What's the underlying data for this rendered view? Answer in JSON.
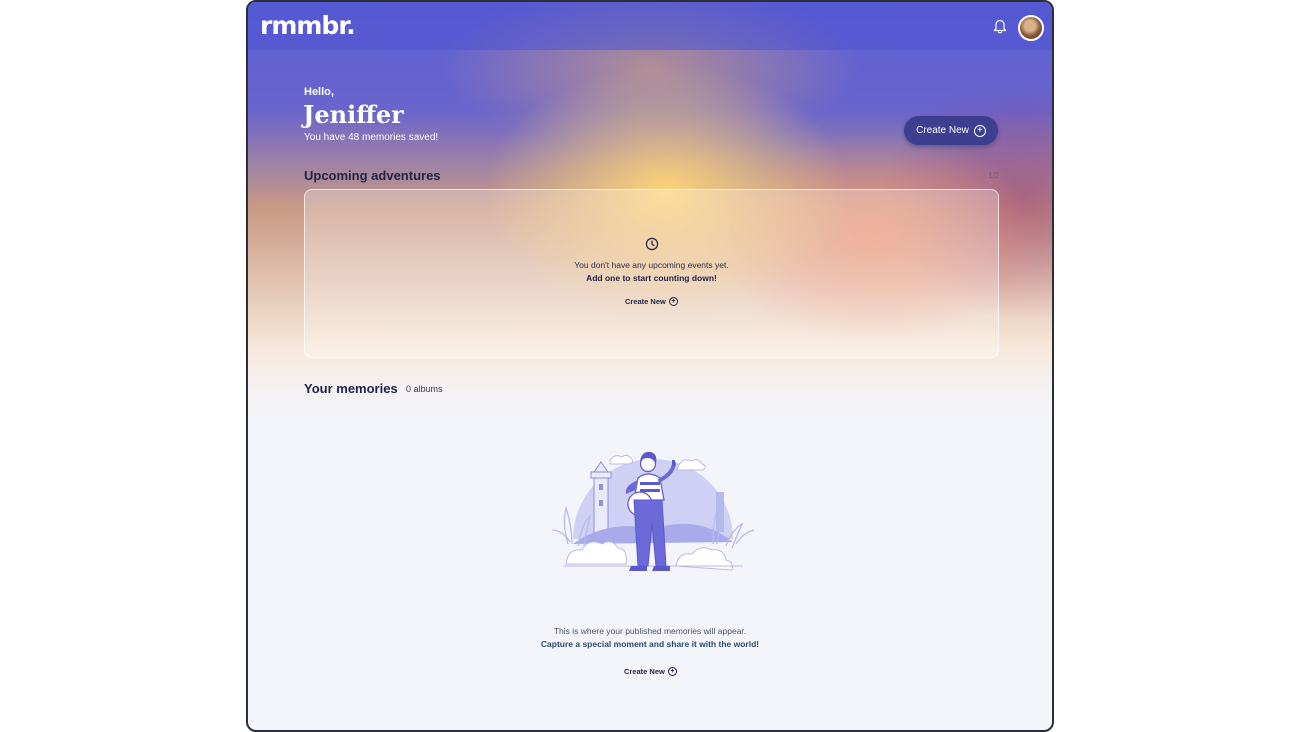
{
  "app": {
    "logo_text": "rmmbr."
  },
  "header": {
    "notification_icon": "bell-icon",
    "avatar_icon": "user-avatar"
  },
  "greeting": {
    "hello": "Hello,",
    "name": "Jeniffer",
    "memory_summary": "You have 48 memories saved!"
  },
  "actions": {
    "create_new_label": "Create New"
  },
  "upcoming": {
    "title": "Upcoming adventures",
    "pager": "1/2",
    "empty_icon": "clock-icon",
    "empty_message": "You don't have any upcoming events yet.",
    "empty_cta": "Add one to start counting down!",
    "create_label": "Create New"
  },
  "memories": {
    "title": "Your memories",
    "album_count": "0 albums",
    "empty_message": "This is where your published memories will appear.",
    "empty_cta": "Capture a special moment and share it with the world!",
    "create_label": "Create New"
  },
  "colors": {
    "brand_indigo": "#5a60d8",
    "button_dark": "#3c3f8f",
    "heading": "#1f2347",
    "illustration": "#6c6ad8"
  }
}
